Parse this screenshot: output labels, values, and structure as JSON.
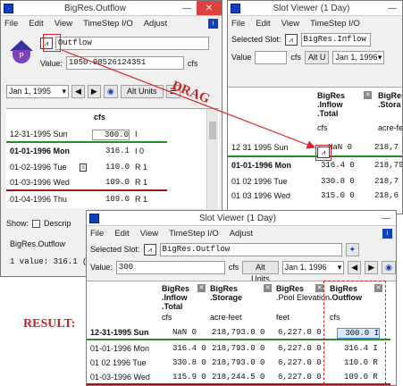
{
  "left_window": {
    "title": "BigRes.Outflow",
    "menu": [
      "File",
      "Edit",
      "View",
      "TimeStep I/O",
      "Adjust"
    ],
    "slot_name": "Outflow",
    "value_label": "Value:",
    "value": "1050.98526124351",
    "value_unit": "cfs",
    "date": "Jan 1, 1995",
    "alt_units": "Alt Units",
    "column_unit": "cfs",
    "rows": [
      {
        "date": "12-31-1995 Sun",
        "value": "300.0",
        "flag": "I"
      },
      {
        "date": "01-01-1996 Mon",
        "value": "316.1",
        "flag": "I  0"
      },
      {
        "date": "01-02-1996 Tue",
        "value": "110.0",
        "flag": "R  1"
      },
      {
        "date": "01-03-1996 Wed",
        "value": "109.0",
        "flag": "R  1"
      },
      {
        "date": "01-04-1996 Thu",
        "value": "109.0",
        "flag": "R  1"
      }
    ],
    "show_label": "Show:",
    "descrip_label": "Descrip",
    "footer_slot": "BigRes.Outflow",
    "footer_value": "1 value:  316.1 (cfs)"
  },
  "right_window": {
    "title": "Slot Viewer (1 Day)",
    "menu": [
      "File",
      "Edit",
      "View",
      "TimeStep I/O"
    ],
    "selected_slot_label": "Selected Slot:",
    "selected_slot": "BigRes.Inflow",
    "value_label": "Value",
    "value_unit": "cfs",
    "alt_units": "Alt U",
    "date": "Jan 1, 1996",
    "col1": [
      "BigRes",
      ".Inflow",
      ".Total",
      "cfs"
    ],
    "col2": [
      "BigRes",
      ".Stora",
      "",
      "acre-fe"
    ],
    "rows": [
      {
        "date": "12 31 1995 Sun",
        "v1": "NaN  0",
        "v2": "218,7"
      },
      {
        "date": "01-01-1996 Mon",
        "v1": "316.4  0",
        "v2": "218,79"
      },
      {
        "date": "01 02 1996 Tue",
        "v1": "330.8  0",
        "v2": "218,7"
      },
      {
        "date": "01 03 1996 Wed",
        "v1": "315.0  0",
        "v2": "218,6"
      }
    ]
  },
  "result_window": {
    "title": "Slot Viewer (1 Day)",
    "menu": [
      "File",
      "Edit",
      "View",
      "TimeStep I/O",
      "Adjust"
    ],
    "selected_slot_label": "Selected Slot:",
    "selected_slot": "BigRes.Outflow",
    "value_label": "Value:",
    "value": "300",
    "value_unit": "cfs",
    "alt_units": "Alt Units",
    "date": "Jan 1, 1996",
    "columns": [
      {
        "lines": [
          "BigRes",
          ".Inflow",
          ".Total",
          "cfs"
        ]
      },
      {
        "lines": [
          "BigRes",
          ".Storage",
          "",
          "acre-feet"
        ]
      },
      {
        "lines": [
          "BigRes",
          ".Pool Elevation",
          "",
          "feet"
        ]
      },
      {
        "lines": [
          "BigRes",
          ".Outflow",
          "",
          "cfs"
        ]
      }
    ],
    "rows": [
      {
        "date": "12-31-1995 Sun",
        "c1": "NaN  0",
        "c2": "218,793.0  0",
        "c3": "6,227.0  0",
        "c4": "300.0  I"
      },
      {
        "date": "01-01-1996 Mon",
        "c1": "316.4  0",
        "c2": "218,793.0  0",
        "c3": "6,227.0  0",
        "c4": "316.4  I"
      },
      {
        "date": "01 02 1996 Tue",
        "c1": "330.8  0",
        "c2": "218,793.0  0",
        "c3": "6,227.0  0",
        "c4": "110.0  R"
      },
      {
        "date": "01-03-1996 Wed",
        "c1": "115.9  0",
        "c2": "218,244.5  0",
        "c3": "6,227.0  0",
        "c4": "109.0  R"
      }
    ]
  },
  "annotations": {
    "drag": "DRAG",
    "result": "RESULT:"
  },
  "colors": {
    "accent_red": "#e02020",
    "title_blue": "#1040c0"
  }
}
